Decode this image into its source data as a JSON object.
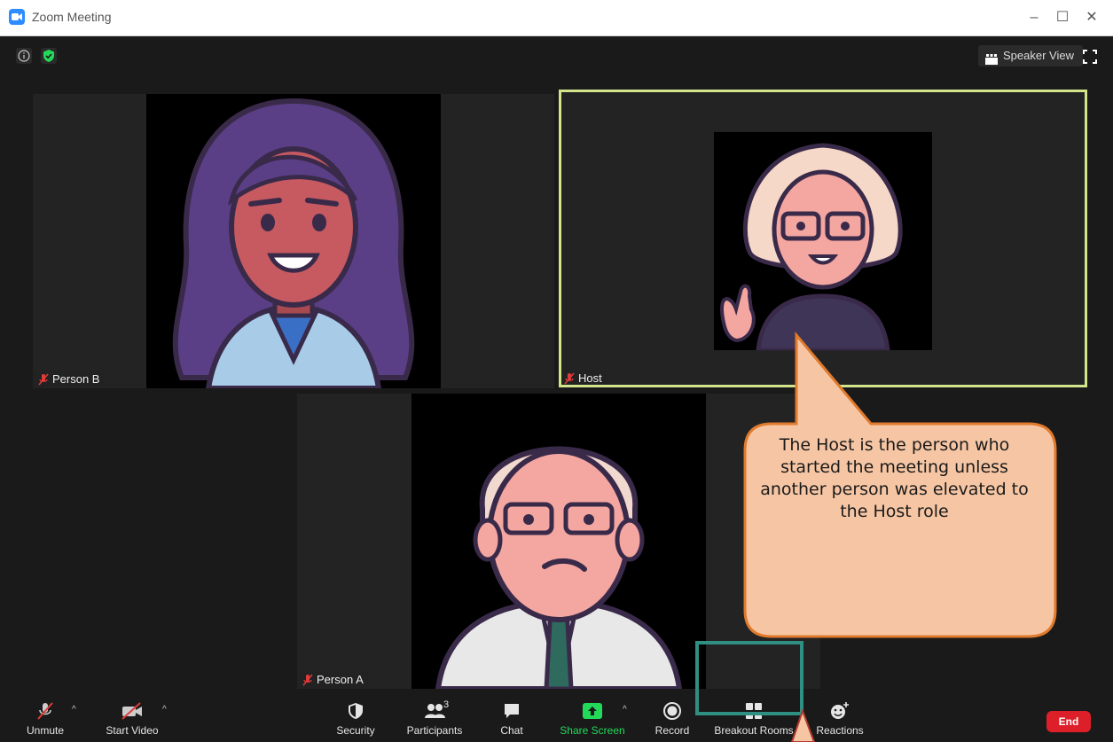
{
  "window": {
    "title": "Zoom Meeting",
    "controls": [
      "minimize-icon",
      "maximize-icon",
      "close-icon"
    ]
  },
  "header": {
    "speaker_view_label": "Speaker View",
    "icons": [
      "info-icon",
      "shield-check-icon",
      "speaker-view-icon",
      "fullscreen-icon"
    ]
  },
  "participants": [
    {
      "name": "Person B",
      "muted": true
    },
    {
      "name": "Host",
      "muted": true,
      "active_speaker": true
    },
    {
      "name": "Person A",
      "muted": true
    }
  ],
  "toolbar": {
    "unmute": "Unmute",
    "start_video": "Start Video",
    "security": "Security",
    "participants": "Participants",
    "participants_count": "3",
    "chat": "Chat",
    "share_screen": "Share Screen",
    "record": "Record",
    "breakout_rooms": "Breakout Rooms",
    "reactions": "Reactions",
    "end": "End"
  },
  "callout": {
    "text": "The Host is the person who started the meeting unless another person was elevated to the Host role"
  },
  "colors": {
    "accent": "#2d8cff",
    "active_speaker_border": "#d3e58b",
    "share_green": "#23d959",
    "end_red": "#dd1f29",
    "callout_fill": "#f6c6a4",
    "callout_border": "#e07a2c",
    "highlight_border": "#2f8f83"
  }
}
